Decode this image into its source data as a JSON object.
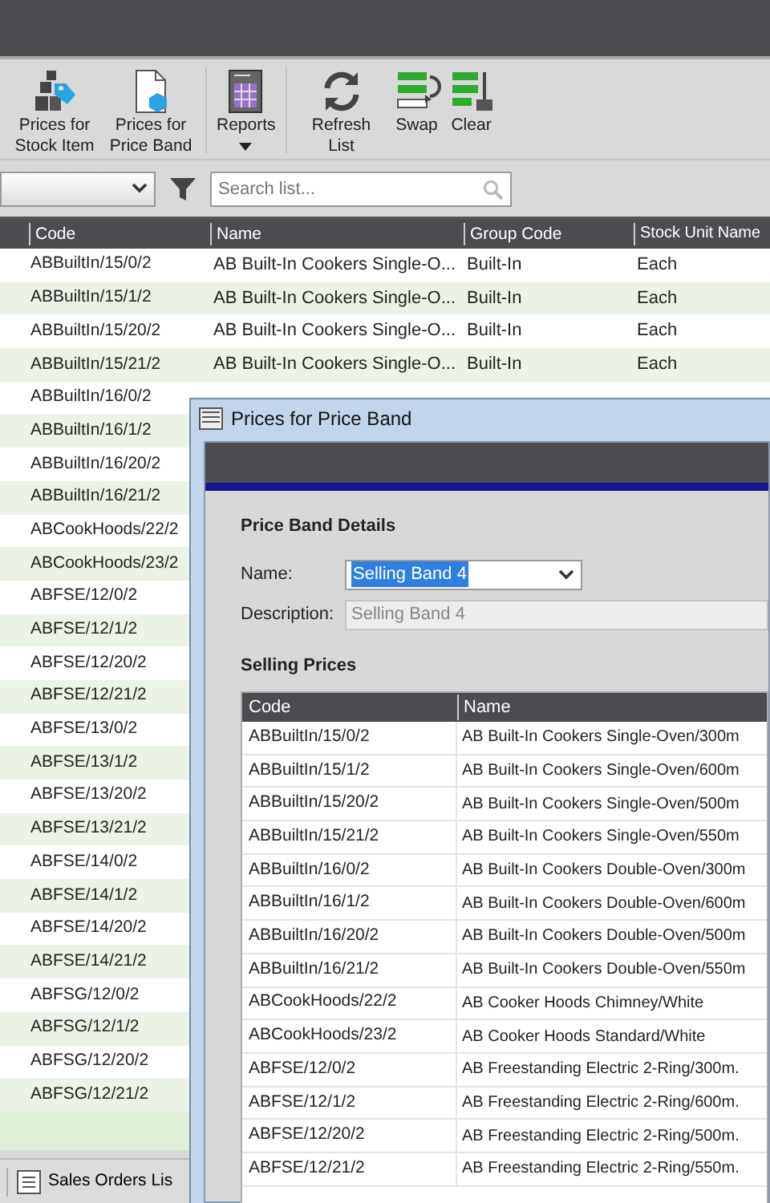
{
  "toolbar": {
    "groups": [
      [
        {
          "label": "Prices for Stock Item",
          "kind": "stock"
        },
        {
          "label": "Prices for Price Band",
          "kind": "band"
        }
      ],
      [
        {
          "label": "Reports",
          "kind": "report",
          "dropdown": true
        }
      ],
      [
        {
          "label": "Refresh List",
          "kind": "refresh"
        },
        {
          "label": "Swap",
          "kind": "swap"
        },
        {
          "label": "Clear",
          "kind": "clear"
        }
      ]
    ]
  },
  "filter": {
    "search_placeholder": "Search list..."
  },
  "list": {
    "columns": [
      "Code",
      "Name",
      "Group Code",
      "Stock Unit Name"
    ],
    "rows": [
      {
        "code": "ABBuiltIn/15/0/2",
        "name": "AB Built-In Cookers Single-O...",
        "group": "Built-In",
        "unit": "Each"
      },
      {
        "code": "ABBuiltIn/15/1/2",
        "name": "AB Built-In Cookers Single-O...",
        "group": "Built-In",
        "unit": "Each"
      },
      {
        "code": "ABBuiltIn/15/20/2",
        "name": "AB Built-In Cookers Single-O...",
        "group": "Built-In",
        "unit": "Each"
      },
      {
        "code": "ABBuiltIn/15/21/2",
        "name": "AB Built-In Cookers Single-O...",
        "group": "Built-In",
        "unit": "Each"
      },
      {
        "code": "ABBuiltIn/16/0/2"
      },
      {
        "code": "ABBuiltIn/16/1/2"
      },
      {
        "code": "ABBuiltIn/16/20/2"
      },
      {
        "code": "ABBuiltIn/16/21/2"
      },
      {
        "code": "ABCookHoods/22/2"
      },
      {
        "code": "ABCookHoods/23/2"
      },
      {
        "code": "ABFSE/12/0/2"
      },
      {
        "code": "ABFSE/12/1/2"
      },
      {
        "code": "ABFSE/12/20/2"
      },
      {
        "code": "ABFSE/12/21/2"
      },
      {
        "code": "ABFSE/13/0/2"
      },
      {
        "code": "ABFSE/13/1/2"
      },
      {
        "code": "ABFSE/13/20/2"
      },
      {
        "code": "ABFSE/13/21/2"
      },
      {
        "code": "ABFSE/14/0/2"
      },
      {
        "code": "ABFSE/14/1/2"
      },
      {
        "code": "ABFSE/14/20/2"
      },
      {
        "code": "ABFSE/14/21/2"
      },
      {
        "code": "ABFSG/12/0/2"
      },
      {
        "code": "ABFSG/12/1/2"
      },
      {
        "code": "ABFSG/12/20/2"
      },
      {
        "code": "ABFSG/12/21/2"
      }
    ]
  },
  "footer": {
    "tab": "Sales Orders Lis"
  },
  "dialog": {
    "title": "Prices for Price Band",
    "details": {
      "heading": "Price Band Details",
      "name_label": "Name:",
      "name_value": "Selling Band 4",
      "name_text_selected": true,
      "description_label": "Description:",
      "description_value": "Selling Band 4"
    },
    "selling_prices": {
      "heading": "Selling Prices",
      "columns": [
        "Code",
        "Name"
      ],
      "rows": [
        {
          "code": "ABBuiltIn/15/0/2",
          "name": "AB Built-In Cookers Single-Oven/300m"
        },
        {
          "code": "ABBuiltIn/15/1/2",
          "name": "AB Built-In Cookers Single-Oven/600m"
        },
        {
          "code": "ABBuiltIn/15/20/2",
          "name": "AB Built-In Cookers Single-Oven/500m"
        },
        {
          "code": "ABBuiltIn/15/21/2",
          "name": "AB Built-In Cookers Single-Oven/550m"
        },
        {
          "code": "ABBuiltIn/16/0/2",
          "name": "AB Built-In Cookers Double-Oven/300m"
        },
        {
          "code": "ABBuiltIn/16/1/2",
          "name": "AB Built-In Cookers Double-Oven/600m"
        },
        {
          "code": "ABBuiltIn/16/20/2",
          "name": "AB Built-In Cookers Double-Oven/500m"
        },
        {
          "code": "ABBuiltIn/16/21/2",
          "name": "AB Built-In Cookers Double-Oven/550m"
        },
        {
          "code": "ABCookHoods/22/2",
          "name": "AB Cooker Hoods Chimney/White"
        },
        {
          "code": "ABCookHoods/23/2",
          "name": "AB Cooker Hoods Standard/White"
        },
        {
          "code": "ABFSE/12/0/2",
          "name": "AB Freestanding Electric 2-Ring/300m."
        },
        {
          "code": "ABFSE/12/1/2",
          "name": "AB Freestanding Electric 2-Ring/600m."
        },
        {
          "code": "ABFSE/12/20/2",
          "name": "AB Freestanding Electric 2-Ring/500m."
        },
        {
          "code": "ABFSE/12/21/2",
          "name": "AB Freestanding Electric 2-Ring/550m."
        }
      ]
    }
  }
}
